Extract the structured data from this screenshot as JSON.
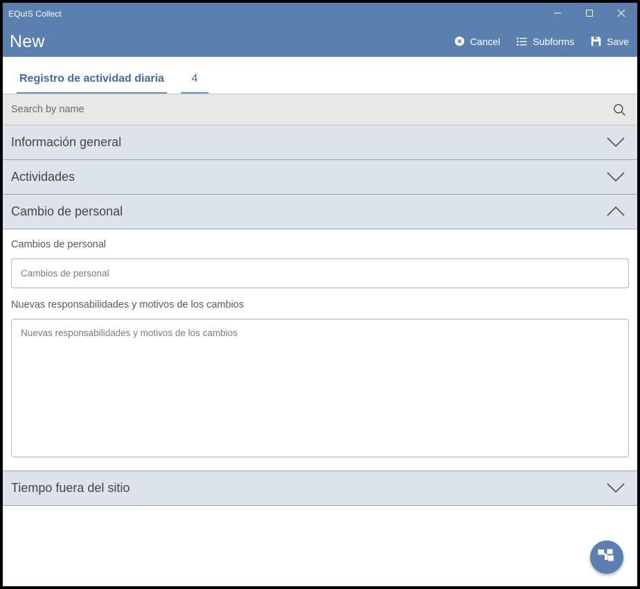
{
  "window": {
    "app_title": "EQuIS Collect",
    "page_title": "New",
    "controls": {
      "minimize": "minimize-button",
      "maximize": "maximize-button",
      "close": "close-button"
    }
  },
  "command_bar": {
    "actions": [
      {
        "label": "Cancel",
        "icon": "cancel-circle-icon"
      },
      {
        "label": "Subforms",
        "icon": "list-icon"
      },
      {
        "label": "Save",
        "icon": "save-floppy-icon"
      }
    ]
  },
  "tabs": [
    {
      "label": "Registro de actividad diaria",
      "active": true
    },
    {
      "label": "4",
      "active": false
    }
  ],
  "search": {
    "placeholder": "Search by name",
    "value": "",
    "icon": "search-icon"
  },
  "sections": [
    {
      "title": "Información general",
      "expanded": false,
      "chevron": "chevron-down-icon"
    },
    {
      "title": "Actividades",
      "expanded": false,
      "chevron": "chevron-down-icon"
    },
    {
      "title": "Cambio de personal",
      "expanded": true,
      "chevron": "chevron-up-icon"
    },
    {
      "title": "Tiempo fuera del sitio",
      "expanded": false,
      "chevron": "chevron-down-icon"
    }
  ],
  "fields": {
    "cambios": {
      "label": "Cambios de personal",
      "placeholder": "Cambios de personal",
      "value": ""
    },
    "responsabilidades": {
      "label": "Nuevas responsabilidades y motivos de los cambios",
      "placeholder": "Nuevas responsabilidades y motivos de los cambios",
      "value": ""
    }
  },
  "fab": {
    "icon": "subform-hierarchy-icon",
    "color": "#5b80b0"
  },
  "colors": {
    "header_blue": "#5b80b0",
    "section_header": "#dde3ea",
    "search_bg": "#e8e8e8",
    "tab_accent": "#3f6aa0",
    "body_bg": "#ffffff"
  }
}
